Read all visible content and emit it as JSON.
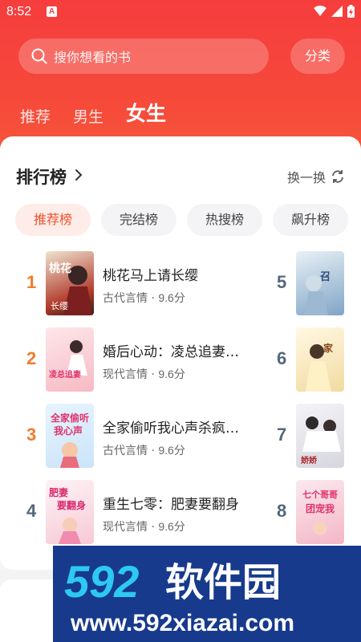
{
  "status_bar": {
    "time": "8:52",
    "notification_icon": "A"
  },
  "search": {
    "placeholder": "搜你想看的书",
    "category_label": "分类"
  },
  "top_tabs": [
    {
      "label": "推荐",
      "active": false
    },
    {
      "label": "男生",
      "active": false
    },
    {
      "label": "女生",
      "active": true
    }
  ],
  "ranking": {
    "title": "排行榜",
    "refresh_label": "换一换",
    "pills": [
      "推荐榜",
      "完结榜",
      "热搜榜",
      "飙升榜"
    ],
    "active_pill": 0,
    "books": [
      {
        "rank": "1",
        "title": "桃花马上请长缨",
        "genre": "古代言情",
        "score": "9.6分",
        "cover_text": "桃花马上请长缨"
      },
      {
        "rank": "2",
        "title": "婚后心动：凌总追妻…",
        "genre": "现代言情",
        "score": "9.6分",
        "cover_text": "凌总追妻有点甜"
      },
      {
        "rank": "3",
        "title": "全家偷听我心声杀疯…",
        "genre": "古代言情",
        "score": "9.6分",
        "cover_text": "全家偷听我心声"
      },
      {
        "rank": "4",
        "title": "重生七零：肥妻要翻身",
        "genre": "现代言情",
        "score": "9.6分",
        "cover_text": "肥妻要翻身"
      }
    ],
    "side_ranks": [
      "5",
      "6",
      "7",
      "8"
    ]
  },
  "watermark": {
    "brand": "592软件园",
    "url": "www.592xiazai.com"
  },
  "colors": {
    "accent": "#f4512e",
    "rank_orange": "#f07d2c",
    "rank_gray": "#55677a",
    "header_red": "#f63d3d"
  }
}
